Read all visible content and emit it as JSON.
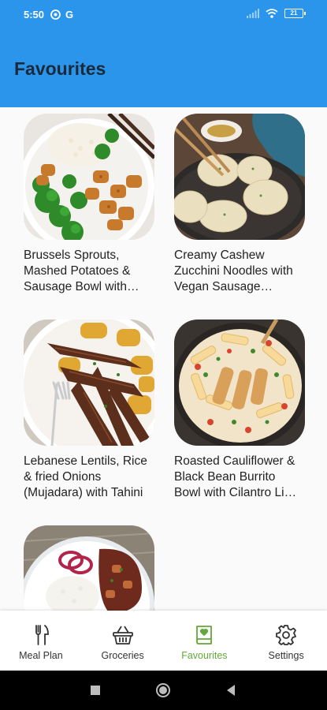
{
  "status_bar": {
    "time": "5:50",
    "g_label": "G",
    "battery": "21"
  },
  "header": {
    "title": "Favourites"
  },
  "favourites": [
    {
      "name": "Brussels Sprouts, Mashed Potatoes & Sausage Bowl with Vegan Gravy"
    },
    {
      "name": "Creamy Cashew Zucchini Noodles with Vegan Sausage Crumbles"
    },
    {
      "name": "Lebanese Lentils, Rice & fried Onions (Mujadara) with Tahini"
    },
    {
      "name": "Roasted Cauliflower & Black Bean Burrito Bowl with Cilantro Lime Dressing"
    },
    {
      "name": ""
    }
  ],
  "nav": {
    "items": [
      {
        "label": "Meal Plan",
        "icon": "utensils-icon"
      },
      {
        "label": "Groceries",
        "icon": "basket-icon"
      },
      {
        "label": "Favourites",
        "icon": "favourite-book-icon"
      },
      {
        "label": "Settings",
        "icon": "gear-icon"
      }
    ],
    "active_color": "#63a83a",
    "accent": "#2b95ec"
  }
}
